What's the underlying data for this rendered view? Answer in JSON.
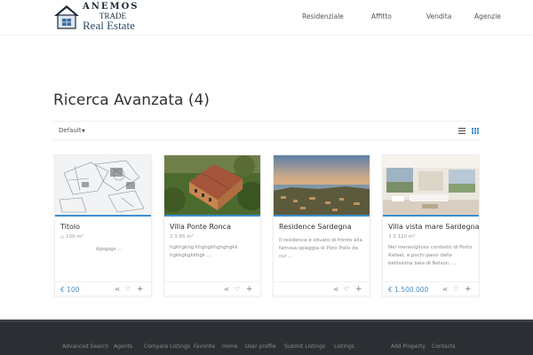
{
  "brand": {
    "line1": "ANEMOS",
    "line2": "TRADE",
    "line3": "Real Estate"
  },
  "nav": {
    "items": [
      "Residenziale",
      "Affitto",
      "Vendita",
      "Agenzie"
    ]
  },
  "page": {
    "title": "Ricerca Avanzata (4)"
  },
  "toolbar": {
    "sort_label": "Default",
    "sort_caret": "▼"
  },
  "cards": [
    {
      "title": "Titolo",
      "meta": "100 m²",
      "desc": "dgsgsgs ...",
      "price": "€ 100"
    },
    {
      "title": "Villa Ponte Ronca",
      "meta": "2   3   85 m²",
      "desc": "hgkhgkhg khghgkhghghgkk hgkkgkgkkhgk ...",
      "price": ""
    },
    {
      "title": "Residence Sardegna",
      "meta": "",
      "desc": "Il residence è situato di fronte alla famosa spiaggia di Poto Pollo da cui ...",
      "price": ""
    },
    {
      "title": "Villa vista mare Sardegna",
      "meta": "3   3   120 m²",
      "desc": "Nel meraviglioso contesto di Porto Rafael, a pochi passi dalla bellissima baia di Nelson, ...",
      "price": "€ 1.500.000"
    }
  ],
  "footer": {
    "links": [
      "Advanced Search",
      "Agents",
      "Compare Listings",
      "Favorite",
      "Home",
      "User profile",
      "Submit Listings",
      "Listings",
      "Add Property",
      "Contacts"
    ]
  },
  "colors": {
    "accent": "#3b8ed0",
    "price": "#4a90c6",
    "footer_bg": "#2b2f33"
  },
  "icons": {
    "share": "share-icon",
    "favorite": "heart-icon",
    "add": "plus-icon",
    "area": "area-icon",
    "list_view": "list-view-icon",
    "grid_view": "grid-view-icon"
  }
}
